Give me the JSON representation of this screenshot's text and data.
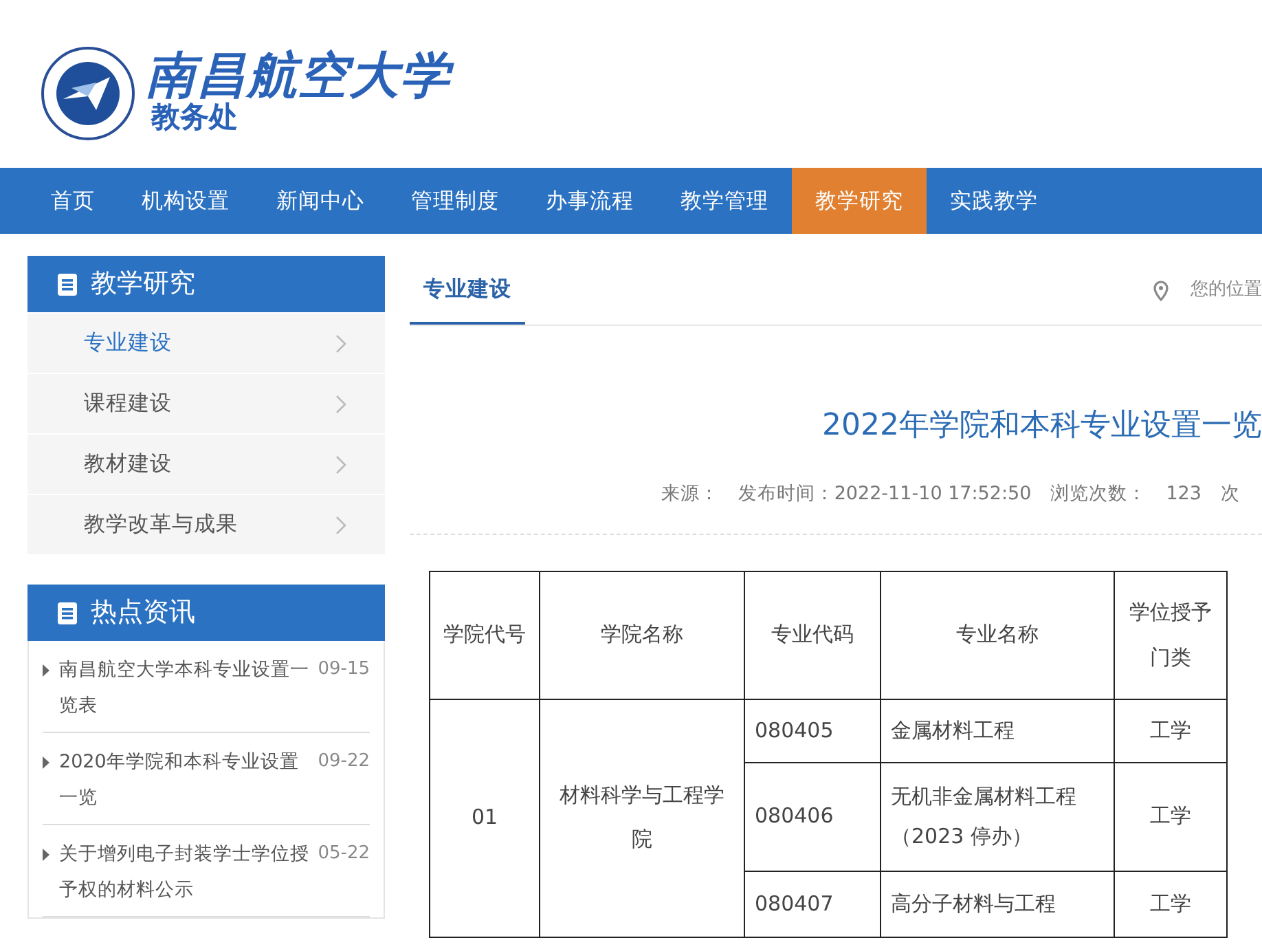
{
  "header": {
    "university_name": "南昌航空大学",
    "department": "教务处"
  },
  "nav": [
    {
      "label": "首页",
      "selected": false
    },
    {
      "label": "机构设置",
      "selected": false
    },
    {
      "label": "新闻中心",
      "selected": false
    },
    {
      "label": "管理制度",
      "selected": false
    },
    {
      "label": "办事流程",
      "selected": false
    },
    {
      "label": "教学管理",
      "selected": false
    },
    {
      "label": "教学研究",
      "selected": true
    },
    {
      "label": "实践教学",
      "selected": false
    }
  ],
  "sidebar": {
    "title": "教学研究",
    "items": [
      {
        "label": "专业建设",
        "selected": true
      },
      {
        "label": "课程建设",
        "selected": false
      },
      {
        "label": "教材建设",
        "selected": false
      },
      {
        "label": "教学改革与成果",
        "selected": false
      }
    ]
  },
  "hot_news": {
    "title": "热点资讯",
    "items": [
      {
        "title": "南昌航空大学本科专业设置一览表",
        "date": "09-15"
      },
      {
        "title": "2020年学院和本科专业设置一览",
        "date": "09-22"
      },
      {
        "title": "关于增列电子封装学士学位授予权的材料公示",
        "date": "05-22"
      }
    ]
  },
  "content": {
    "tab": "专业建设",
    "location_label": "您的位置",
    "article_title": "2022年学院和本科专业设置一览",
    "meta": {
      "source": "来源：",
      "published": "发布时间：2022-11-10 17:52:50",
      "views_label": "浏览次数：",
      "views": "123",
      "views_unit": "次"
    },
    "table": {
      "columns": [
        "学院代号",
        "学院名称",
        "专业代码",
        "专业名称",
        "学位授予门类"
      ],
      "rows": [
        {
          "college_code": "01",
          "college_name": "材料科学与工程学院",
          "majors": [
            {
              "code": "080405",
              "name": "金属材料工程",
              "degree": "工学"
            },
            {
              "code": "080406",
              "name": "无机非金属材料工程（2023 停办）",
              "degree": "工学"
            },
            {
              "code": "080407",
              "name": "高分子材料与工程",
              "degree": "工学"
            }
          ]
        }
      ]
    }
  }
}
